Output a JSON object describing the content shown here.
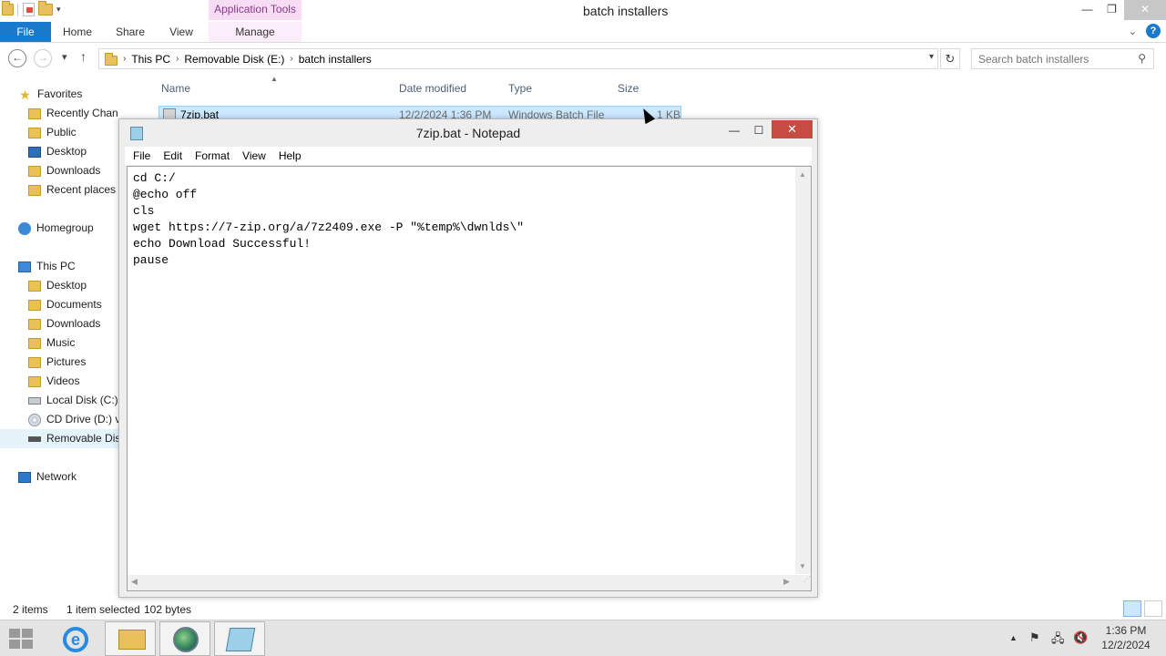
{
  "explorer": {
    "window_title": "batch installers",
    "contextual_tab": "Application Tools",
    "ribbon_tabs": [
      "File",
      "Home",
      "Share",
      "View",
      "Manage"
    ],
    "breadcrumb": [
      "This PC",
      "Removable Disk (E:)",
      "batch installers"
    ],
    "search_placeholder": "Search batch installers",
    "nav": {
      "favorites": "Favorites",
      "favorites_items": [
        "Recently Changed",
        "Public",
        "Desktop",
        "Downloads",
        "Recent places"
      ],
      "homegroup": "Homegroup",
      "this_pc": "This PC",
      "this_pc_items": [
        "Desktop",
        "Documents",
        "Downloads",
        "Music",
        "Pictures",
        "Videos",
        "Local Disk (C:)",
        "CD Drive (D:) vi",
        "Removable Dis"
      ],
      "network": "Network"
    },
    "columns": [
      "Name",
      "Date modified",
      "Type",
      "Size"
    ],
    "files": [
      {
        "name": "7zip.bat",
        "date_modified": "12/2/2024 1:36 PM",
        "type": "Windows Batch File",
        "size": "1 KB"
      }
    ],
    "status": {
      "item_count": "2 items",
      "selection": "1 item selected",
      "size": "102 bytes"
    }
  },
  "notepad": {
    "title": "7zip.bat - Notepad",
    "menu": [
      "File",
      "Edit",
      "Format",
      "View",
      "Help"
    ],
    "content": "cd C:/\n@echo off\ncls\nwget https://7-zip.org/a/7z2409.exe -P \"%temp%\\dwnlds\\\"\necho Download Successful!\npause"
  },
  "taskbar": {
    "time": "1:36 PM",
    "date": "12/2/2024",
    "apps": [
      "internet-explorer",
      "file-explorer",
      "globe-app",
      "notepad"
    ]
  },
  "colors": {
    "accent": "#1979ca",
    "selection": "#cce8ff",
    "close_red": "#c74b43",
    "contextual_tab": "#f7ddf3"
  }
}
